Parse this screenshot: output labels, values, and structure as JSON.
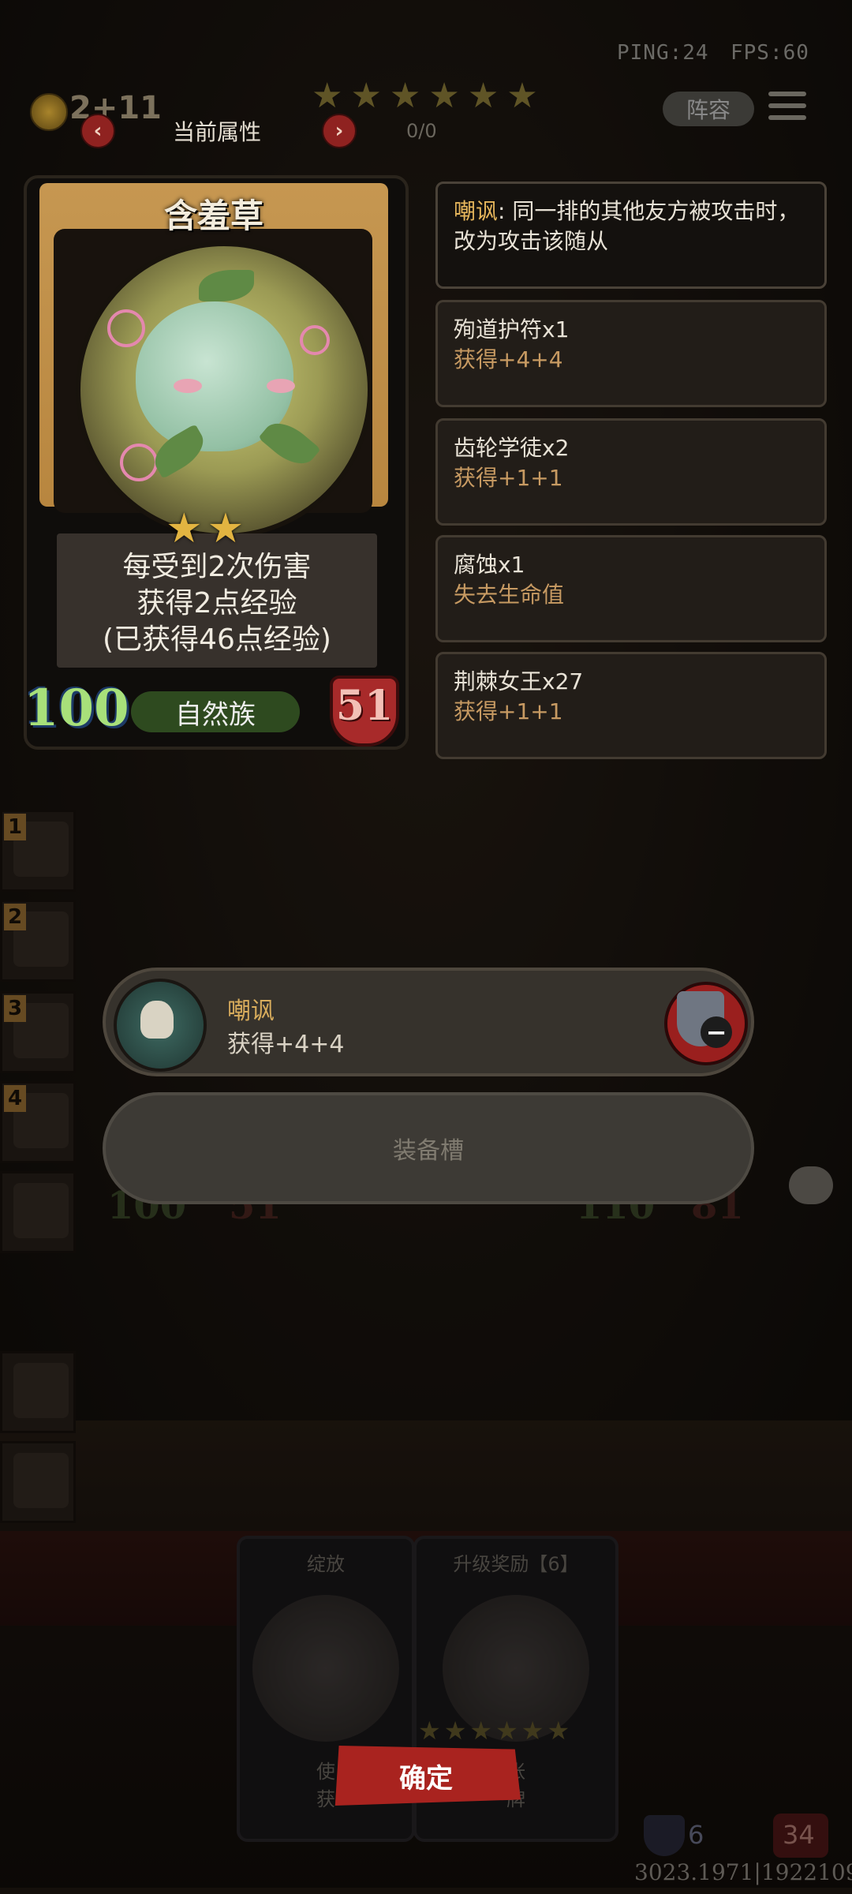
{
  "hud": {
    "ping": "PING:24",
    "fps": "FPS:60",
    "gold": "2+11",
    "progress": "0/0",
    "star_count": 6,
    "team_button": "阵容"
  },
  "attr_header": {
    "title": "当前属性",
    "prev": "‹",
    "next": "›"
  },
  "card": {
    "name": "含羞草",
    "stars": 2,
    "desc_line1": "每受到2次伤害",
    "desc_line2": "获得2点经验",
    "desc_line3": "(已获得46点经验)",
    "tribe": "自然族",
    "attack": "100",
    "health": "51"
  },
  "effects": [
    {
      "keyword": "嘲讽",
      "text": ": 同一排的其他友方被攻击时，改为攻击该随从"
    },
    {
      "title": "殉道护符x1",
      "detail": "获得+4+4"
    },
    {
      "title": "齿轮学徒x2",
      "detail": "获得+1+1"
    },
    {
      "title": "腐蚀x1",
      "detail": "失去生命值"
    },
    {
      "title": "荆棘女王x27",
      "detail": "获得+1+1"
    }
  ],
  "equipment": {
    "equipped_name": "嘲讽",
    "equipped_desc": "获得+4+4",
    "remove_icon": "−",
    "empty_slot_label": "装备槽"
  },
  "roster": [
    "1",
    "2",
    "3",
    "4"
  ],
  "ghost_stats": {
    "left_atk": "100",
    "left_hp": "51",
    "right_atk": "110",
    "right_hp": "81"
  },
  "bottom_cards": {
    "left_title": "绽放",
    "right_title": "升级奖励【6】",
    "left_footer": "使\n获",
    "right_footer": "张\n牌"
  },
  "confirm_label": "确定",
  "bottom_right": {
    "shield": "6",
    "hp": "34"
  },
  "coords_text": "3023.1971|1922109",
  "colors": {
    "accent_red": "#a9231f",
    "gold": "#e6b65c",
    "tribe_green": "#2e4a1f",
    "attack_green": "#a8e07a"
  }
}
